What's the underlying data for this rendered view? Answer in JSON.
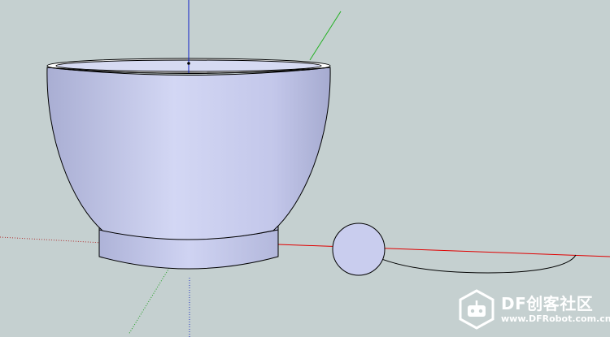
{
  "viewport": {
    "background_color": "#c5d0d0",
    "axes": {
      "red_axis_color": "#e00000",
      "green_axis_color": "#20b020",
      "blue_axis_color": "#1020c8"
    },
    "model": {
      "object": "bowl",
      "fill_color": "#c9cdee",
      "shade_color": "#9a9fc4",
      "edge_color": "#000000"
    },
    "tools": {
      "circle_path_profile": "circle",
      "follow_path_curve": "arc"
    }
  },
  "watermark": {
    "brand": "DF创客社区",
    "site": "www.DFRobot.com.cn",
    "logo_icon": "robot-logo-icon"
  }
}
